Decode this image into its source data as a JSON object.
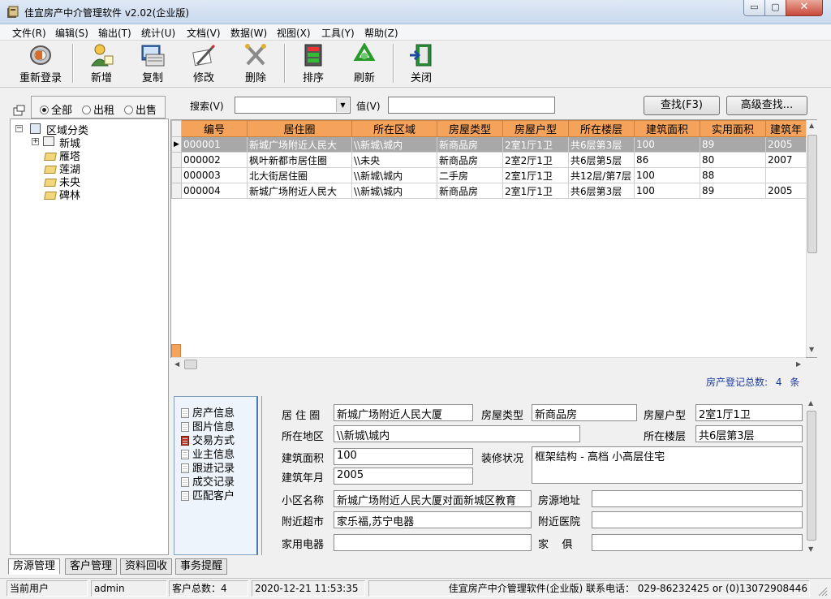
{
  "window": {
    "title": "佳宜房产中介管理软件 v2.02(企业版)",
    "minimize": "▭",
    "maximize": "▢",
    "close": "✕"
  },
  "menu": [
    "文件(R)",
    "编辑(S)",
    "输出(T)",
    "统计(U)",
    "文档(V)",
    "数据(W)",
    "视图(X)",
    "工具(Y)",
    "帮助(Z)"
  ],
  "toolbar": {
    "relogin": "重新登录",
    "add": "新增",
    "copy": "复制",
    "edit": "修改",
    "delete": "删除",
    "sort": "排序",
    "refresh": "刷新",
    "close": "关闭"
  },
  "filter": {
    "all": "全部",
    "rent": "出租",
    "sale": "出售",
    "selected": "all"
  },
  "tree": {
    "root": "区域分类",
    "city": "新城",
    "children": [
      "雁塔",
      "莲湖",
      "未央",
      "碑林"
    ]
  },
  "search": {
    "search_label": "搜索(V)",
    "value_label": "值(V)",
    "find_button": "查找(F3)",
    "advanced_button": "高级查找..."
  },
  "grid": {
    "columns": [
      "编号",
      "居住圈",
      "所在区域",
      "房屋类型",
      "房屋户型",
      "所在楼层",
      "建筑面积",
      "实用面积",
      "建筑年"
    ],
    "rows": [
      [
        "000001",
        "新城广场附近人民大",
        "\\\\新城\\城内",
        "新商品房",
        "2室1厅1卫",
        "共6层第3层",
        "100",
        "89",
        "2005"
      ],
      [
        "000002",
        "枫叶新都市居住圈",
        "\\\\未央",
        "新商品房",
        "2室2厅1卫",
        "共6层第5层",
        "86",
        "80",
        "2007"
      ],
      [
        "000003",
        "北大街居住圈",
        "\\\\新城\\城内",
        "二手房",
        "2室1厅1卫",
        "共12层/第7层",
        "100",
        "88",
        ""
      ],
      [
        "000004",
        "新城广场附近人民大",
        "\\\\新城\\城内",
        "新商品房",
        "2室1厅1卫",
        "共6层第3层",
        "100",
        "89",
        "2005"
      ]
    ],
    "selected_row": 0,
    "total_label": "房产登记总数:",
    "total_count": "4",
    "total_unit": "条"
  },
  "info_list": [
    "房产信息",
    "图片信息",
    "交易方式",
    "业主信息",
    "跟进记录",
    "成交记录",
    "匹配客户"
  ],
  "detail": {
    "labels": {
      "circle": "居 住 圈",
      "type": "房屋类型",
      "layout": "房屋户型",
      "district": "所在地区",
      "floor": "所在楼层",
      "area": "建筑面积",
      "decoration": "装修状况",
      "year": "建筑年月",
      "community": "小区名称",
      "address": "房源地址",
      "market": "附近超市",
      "hospital": "附近医院",
      "appliance": "家用电器",
      "furniture": "家    俱"
    },
    "values": {
      "circle": "新城广场附近人民大厦",
      "type": "新商品房",
      "layout": "2室1厅1卫",
      "district": "\\\\新城\\城内",
      "floor": "共6层第3层",
      "area": "100",
      "decoration": "框架结构 - 高档 小高层住宅",
      "year": "2005",
      "community": "新城广场附近人民大厦对面新城区教育",
      "address": "",
      "market": "家乐福,苏宁电器",
      "hospital": "",
      "appliance": "",
      "furniture": ""
    }
  },
  "tabs": [
    "房源管理",
    "客户管理",
    "资料回收",
    "事务提醒"
  ],
  "status": {
    "user_label": "当前用户",
    "user": "admin",
    "clients": "客户总数：4",
    "datetime": "2020-12-21 11:53:35",
    "contact": "佳宜房产中介管理软件(企业版) 联系电话： 029-86232425 or (0)13072908446"
  }
}
